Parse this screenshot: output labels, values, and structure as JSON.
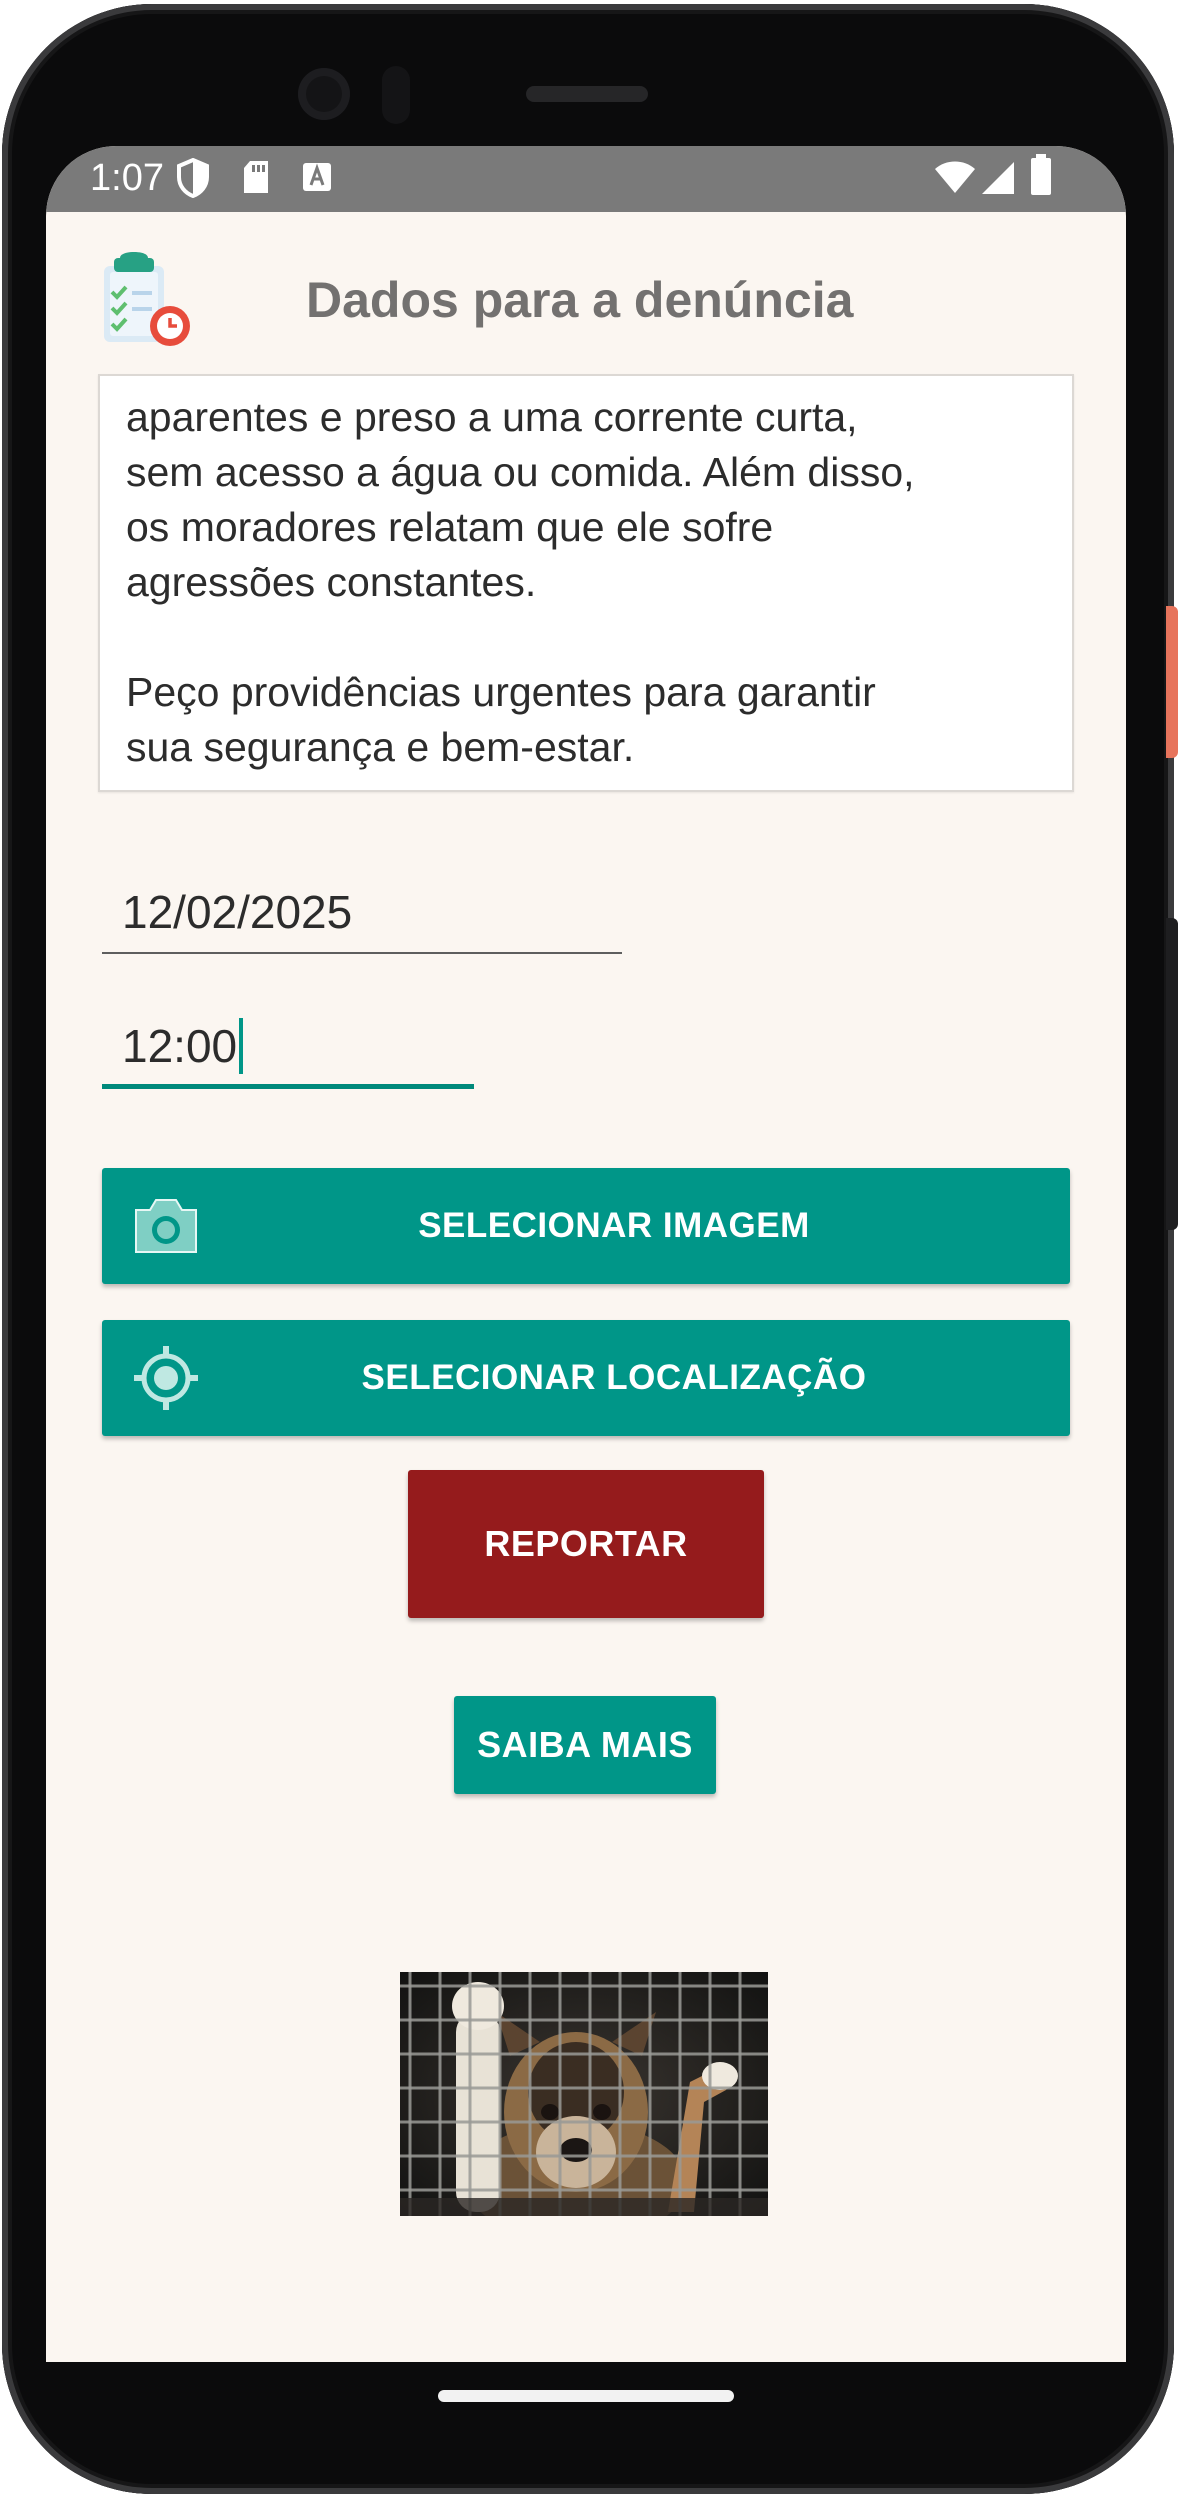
{
  "status_bar": {
    "time": "1:07",
    "icons_left": [
      "shield-icon",
      "sd-card-icon",
      "text-a-icon"
    ],
    "icons_right": [
      "wifi-icon",
      "signal-icon",
      "battery-icon"
    ]
  },
  "header": {
    "title": "Dados para a denúncia",
    "logo_icon": "clipboard-checklist-clock-icon"
  },
  "description": {
    "text": "aparentes e preso a uma corrente curta,\nsem acesso a água ou comida. Além disso,\nos moradores relatam que ele sofre\nagressões constantes.\n\nPeço providências urgentes para garantir\nsua segurança e bem-estar."
  },
  "form": {
    "date_value": "12/02/2025",
    "time_value": "12:00"
  },
  "buttons": {
    "select_image": "SELECIONAR IMAGEM",
    "select_image_icon": "camera-icon",
    "select_location": "SELECIONAR LOCALIZAÇÃO",
    "select_location_icon": "location-target-icon",
    "report": "REPORTAR",
    "learn_more": "SAIBA MAIS"
  },
  "colors": {
    "primary": "#009688",
    "report": "#951b1c",
    "background": "#fbf6f1",
    "status_bar": "#7a7a7a",
    "title": "#737170"
  },
  "image": {
    "subject": "dog-behind-cage-photo"
  }
}
